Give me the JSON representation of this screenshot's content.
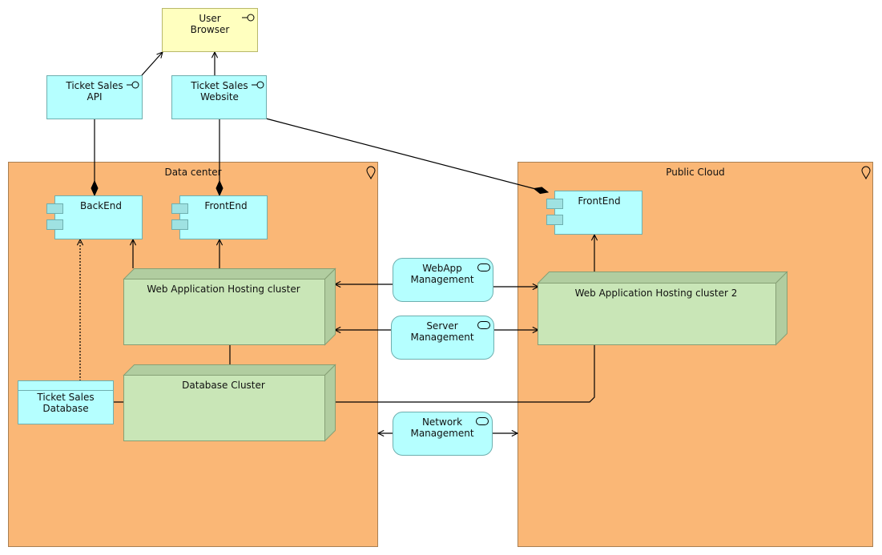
{
  "colors": {
    "location_fill": "#fab776",
    "location_stroke": "#a97f52",
    "app_fill": "#b5ffff",
    "app_stroke": "#6eafaf",
    "app_port_fill": "#9fe2e2",
    "business_fill": "#ffffbf",
    "business_stroke": "#b8b86a",
    "node_front": "#c9e6b7",
    "node_side": "#b1cda0",
    "node_stroke": "#86a075",
    "edge": "#000000"
  },
  "locations": {
    "data_center": {
      "label": "Data center",
      "icon": "location-pin-icon"
    },
    "public_cloud": {
      "label": "Public Cloud",
      "icon": "location-pin-icon"
    }
  },
  "interfaces": {
    "user_browser": {
      "line1": "User",
      "line2": "Browser",
      "icon": "interface-icon"
    },
    "api": {
      "line1": "Ticket Sales",
      "line2": "API",
      "icon": "interface-icon"
    },
    "website": {
      "line1": "Ticket Sales",
      "line2": "Website",
      "icon": "interface-icon"
    }
  },
  "components": {
    "dc_backend": {
      "label": "BackEnd",
      "icon": "component-icon"
    },
    "dc_frontend": {
      "label": "FrontEnd",
      "icon": "component-icon"
    },
    "pc_frontend": {
      "label": "FrontEnd",
      "icon": "component-icon"
    }
  },
  "nodes": {
    "web_cluster": {
      "label": "Web Application Hosting cluster"
    },
    "web_cluster_2": {
      "label": "Web Application Hosting cluster 2"
    },
    "db_cluster": {
      "label": "Database Cluster"
    }
  },
  "data_objects": {
    "ticket_db": {
      "line1": "Ticket Sales",
      "line2": "Database"
    }
  },
  "services": {
    "webapp_mgmt": {
      "line1": "WebApp",
      "line2": "Management",
      "icon": "service-icon"
    },
    "server_mgmt": {
      "line1": "Server",
      "line2": "Management",
      "icon": "service-icon"
    },
    "network_mgmt": {
      "line1": "Network",
      "line2": "Management",
      "icon": "service-icon"
    }
  }
}
